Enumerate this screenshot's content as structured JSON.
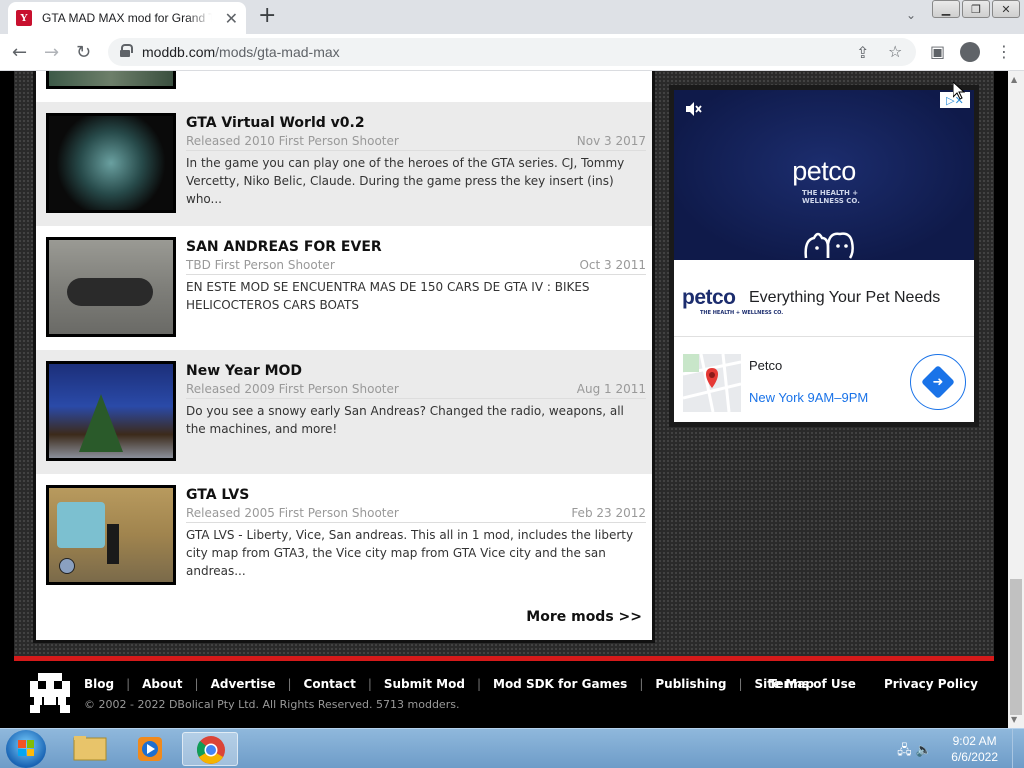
{
  "browser": {
    "tab_title": "GTA MAD MAX mod for Grand Theft Auto",
    "url_domain": "moddb.com",
    "url_path": "/mods/gta-mad-max"
  },
  "mods": [
    {
      "title": "GTA Virtual World v0.2",
      "meta": "Released 2010 First Person Shooter",
      "date": "Nov 3 2017",
      "description": "In the game you can play one of the heroes of the GTA series. CJ, Tommy Vercetty, Niko Belic, Claude. During the game press the key insert (ins) who..."
    },
    {
      "title": "SAN ANDREAS FOR EVER",
      "meta": "TBD First Person Shooter",
      "date": "Oct 3 2011",
      "description": "EN ESTE MOD SE ENCUENTRA MAS DE 150 CARS DE GTA IV : BIKES HELICOCTEROS CARS BOATS"
    },
    {
      "title": "New Year MOD",
      "meta": "Released 2009 First Person Shooter",
      "date": "Aug 1 2011",
      "description": "Do you see a snowy early San Andreas? Changed the radio, weapons, all the machines, and more!"
    },
    {
      "title": "GTA LVS",
      "meta": "Released 2005 First Person Shooter",
      "date": "Feb 23 2012",
      "description": "GTA LVS - Liberty, Vice, San andreas. This all in 1 mod, includes the liberty city map from GTA3, the Vice city map from GTA Vice city and the san andreas..."
    }
  ],
  "more_mods": "More mods >>",
  "ad": {
    "brand": "petco",
    "brand_sub": "THE HEALTH + WELLNESS CO.",
    "headline": "Everything Your Pet Needs",
    "place": "Petco",
    "hours": "New York 9AM–9PM"
  },
  "footer": {
    "links": [
      "Blog",
      "About",
      "Advertise",
      "Contact",
      "Submit Mod",
      "Mod SDK for Games",
      "Publishing",
      "Site Map"
    ],
    "right_links": [
      "Terms of Use",
      "Privacy Policy"
    ],
    "copyright": "© 2002 - 2022 DBolical Pty Ltd.  All Rights Reserved.  5713 modders."
  },
  "taskbar": {
    "time": "9:02 AM",
    "date": "6/6/2022"
  },
  "colors": {
    "accent_red": "#d51a1a",
    "petco_blue": "#1c2d6e",
    "link_blue": "#1a73e8"
  }
}
